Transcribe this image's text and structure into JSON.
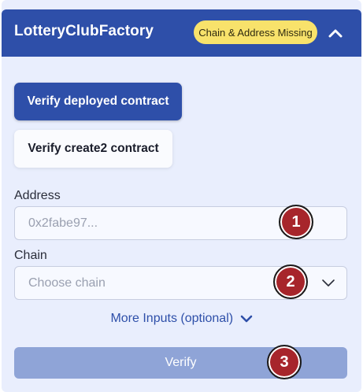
{
  "header": {
    "title": "LotteryClubFactory",
    "badge": "Chain & Address Missing"
  },
  "buttons": {
    "verify_deployed": "Verify deployed contract",
    "verify_create2": "Verify create2 contract",
    "verify": "Verify"
  },
  "address": {
    "label": "Address",
    "placeholder": "0x2fabe97..."
  },
  "chain": {
    "label": "Chain",
    "placeholder": "Choose chain"
  },
  "more_inputs": "More Inputs (optional)",
  "markers": [
    "1",
    "2",
    "3"
  ],
  "colors": {
    "header_bg": "#2e4fa9",
    "panel_bg": "#e9eefd",
    "badge_bg": "#f8e26b",
    "verify_disabled_bg": "#8fa4d7",
    "marker_bg": "#a7252b"
  }
}
